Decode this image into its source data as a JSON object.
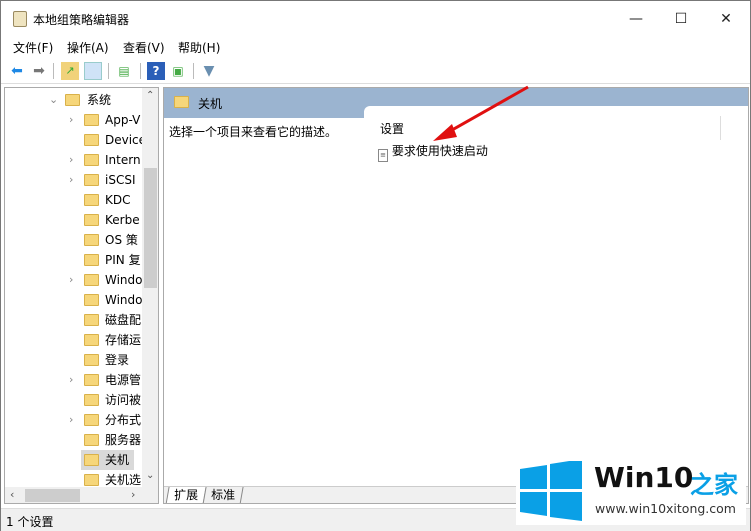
{
  "window": {
    "title": "本地组策略编辑器",
    "minimize": "—",
    "maximize": "☐",
    "close": "✕"
  },
  "menu": [
    "文件(F)",
    "操作(A)",
    "查看(V)",
    "帮助(H)"
  ],
  "toolbar": [
    "back-icon",
    "forward-icon",
    "up-folder-icon",
    "show-hide-tree-icon",
    "export-list-icon",
    "help-icon",
    "show-hide-action-pane-icon",
    "filter-icon"
  ],
  "tree": {
    "parent": "系统",
    "items": [
      {
        "label": "App-V",
        "expandable": true
      },
      {
        "label": "Device",
        "expandable": false
      },
      {
        "label": "Intern",
        "expandable": true
      },
      {
        "label": "iSCSI",
        "expandable": true
      },
      {
        "label": "KDC",
        "expandable": false
      },
      {
        "label": "Kerbe",
        "expandable": false
      },
      {
        "label": "OS 策",
        "expandable": false
      },
      {
        "label": "PIN 复",
        "expandable": false
      },
      {
        "label": "Windo",
        "expandable": true
      },
      {
        "label": "Windo",
        "expandable": false
      },
      {
        "label": "磁盘配",
        "expandable": false
      },
      {
        "label": "存储运",
        "expandable": false
      },
      {
        "label": "登录",
        "expandable": false
      },
      {
        "label": "电源管",
        "expandable": true
      },
      {
        "label": "访问被",
        "expandable": false
      },
      {
        "label": "分布式",
        "expandable": true
      },
      {
        "label": "服务器",
        "expandable": false
      },
      {
        "label": "关机",
        "expandable": false,
        "selected": true
      },
      {
        "label": "关机选",
        "expandable": false
      }
    ]
  },
  "main": {
    "header": "关机",
    "description": "选择一个项目来查看它的描述。",
    "column_header": "设置",
    "settings": [
      "要求使用快速启动"
    ],
    "tabs": [
      "扩展",
      "标准"
    ]
  },
  "status": "1 个设置",
  "watermark": {
    "brand": "Win10",
    "brand_cn": "之家",
    "url": "www.win10xitong.com",
    "color": "#0aa0e6"
  },
  "colors": {
    "header": "#9bb4d0",
    "arrow": "#e01010"
  }
}
